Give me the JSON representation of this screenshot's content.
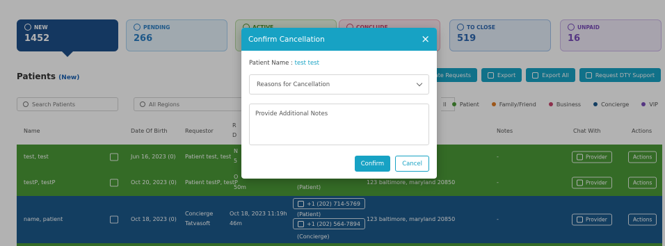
{
  "cards": [
    {
      "key": "new",
      "label": "NEW",
      "count": "1452",
      "icon": "circle-plus-icon"
    },
    {
      "key": "pending",
      "label": "PENDING",
      "count": "266",
      "icon": "user-clock-icon"
    },
    {
      "key": "active",
      "label": "ACTIVE",
      "count": "",
      "icon": "check-icon"
    },
    {
      "key": "conclude",
      "label": "CONCLUDE",
      "count": "",
      "icon": "users-icon"
    },
    {
      "key": "toclose",
      "label": "TO CLOSE",
      "count": "519",
      "icon": "close-list-icon"
    },
    {
      "key": "unpaid",
      "label": "UNPAID",
      "count": "16",
      "icon": "dollar-icon"
    }
  ],
  "page": {
    "title": "Patients",
    "subtitle": "(New)"
  },
  "toolbar": {
    "create_requests": "reate Requests",
    "export": "Export",
    "export_all": "Export All",
    "request_support": "Request DTY Support"
  },
  "filters": {
    "search_placeholder": "Search Patients",
    "regions_label": "All Regions",
    "all_chip": "ll"
  },
  "legend": [
    {
      "label": "Patient",
      "color": "#4b9a37"
    },
    {
      "label": "Family/Friend",
      "color": "#e07b24"
    },
    {
      "label": "Business",
      "color": "#c9456e"
    },
    {
      "label": "Concierge",
      "color": "#1c5a8c"
    },
    {
      "label": "VIP",
      "color": "#7a4dba"
    }
  ],
  "table": {
    "headers": {
      "name": "Name",
      "dob": "Date Of Birth",
      "requestor": "Requestor",
      "requested_partial": "R",
      "requested_partial2": "D",
      "notes": "Notes",
      "chat_with": "Chat With",
      "actions": "Actions"
    },
    "rows": [
      {
        "name": "test, test",
        "dob": "Jun 16, 2023 (0)",
        "requestor": "Patient test, test",
        "date_frag1": "N",
        "date_frag2": "5",
        "chat": "Provider",
        "notes": "-",
        "actions": "Actions"
      },
      {
        "name": "testP, testP",
        "dob": "Oct 20, 2023 (0)",
        "requestor": "Patient testP, testP",
        "date_frag1": "O",
        "date_frag2": "50m",
        "phone_tag": "(Patient)",
        "address": "123 baltimore, maryland 20850",
        "chat": "Provider",
        "notes": "-",
        "actions": "Actions"
      },
      {
        "name": "name, patient",
        "dob": "Oct 18, 2023 (0)",
        "requestor_line1": "Concierge",
        "requestor_line2": "Tatvasoft",
        "requested_line1": "Oct 18, 2023 11:19h",
        "requested_line2": "46m",
        "phone1": "+1 (202) 714-5769",
        "phone1_tag": "(Patient)",
        "phone2": "+1 (202) 564-7894",
        "phone2_tag": "(Concierge)",
        "address": "123 baltimore, maryland 20850",
        "chat": "Provider",
        "notes": "-",
        "actions": "Actions"
      }
    ]
  },
  "modal": {
    "title": "Confirm Cancellation",
    "close_glyph": "×",
    "patient_label": "Patient Name :",
    "patient_value": "test test",
    "reasons_placeholder": "Reasons for Cancellation",
    "notes_placeholder": "Provide Additional Notes",
    "confirm_label": "Confirm",
    "cancel_label": "Cancel"
  }
}
